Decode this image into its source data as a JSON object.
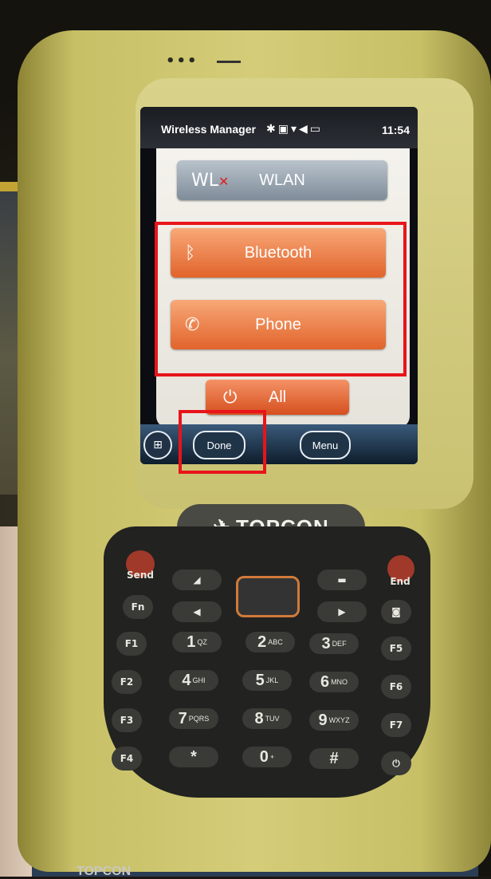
{
  "statusbar": {
    "title": "Wireless Manager",
    "icons": [
      "bluetooth-icon",
      "h-icon",
      "signal-icon",
      "volume-icon",
      "battery-icon"
    ],
    "time": "11:54"
  },
  "buttons": {
    "wlan": {
      "label": "WLAN",
      "logo": "WL"
    },
    "bluetooth": {
      "label": "Bluetooth"
    },
    "phone": {
      "label": "Phone"
    },
    "all": {
      "label": "All"
    }
  },
  "taskbar": {
    "done_label": "Done",
    "menu_label": "Menu"
  },
  "device": {
    "brand": "TOPCON",
    "bottom_brand": "TOPCON",
    "keys": {
      "send": "Send",
      "end": "End",
      "fn": "Fn",
      "f1": "F1",
      "f2": "F2",
      "f3": "F3",
      "f4": "F4",
      "f5": "F5",
      "f6": "F6",
      "f7": "F7",
      "one": "1",
      "one_sub": "QZ",
      "two": "2",
      "two_sub": "ABC",
      "three": "3",
      "three_sub": "DEF",
      "four": "4",
      "four_sub": "GHI",
      "five": "5",
      "five_sub": "JKL",
      "six": "6",
      "six_sub": "MNO",
      "seven": "7",
      "seven_sub": "PQRS",
      "eight": "8",
      "eight_sub": "TUV",
      "nine": "9",
      "nine_sub": "WXYZ",
      "zero": "0",
      "zero_sub": "+",
      "star": "*",
      "hash": "#"
    }
  },
  "colors": {
    "highlight": "#e8141a",
    "orange_button": "#e1642b",
    "wlan_button": "#7f8c99"
  }
}
